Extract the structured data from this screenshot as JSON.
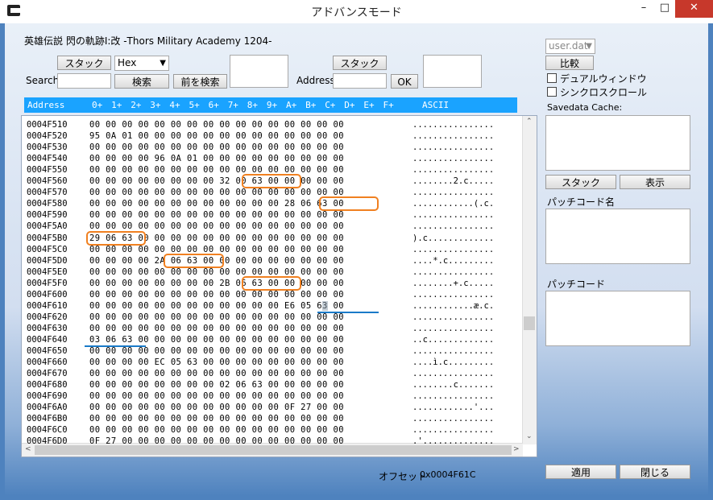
{
  "window": {
    "title": "アドバンスモード",
    "min": "–",
    "max": "□",
    "close": "✕"
  },
  "game_title": "英雄伝説 閃の軌跡I:改 -Thors Military Academy 1204-",
  "stack1_label": "スタック",
  "format_select": "Hex",
  "search_label": "Search",
  "search_value": "",
  "search_button": "検索",
  "prev_search_button": "前を検索",
  "stack2_label": "スタック",
  "address_label": "Address",
  "address_value": "",
  "ok_button": "OK",
  "file_select": "user.dat",
  "compare_button": "比較",
  "dual_window_label": "デュアルウィンドウ",
  "sync_scroll_label": "シンクロスクロール",
  "savedata_cache_label": "Savedata Cache:",
  "cache_stack_button": "スタック",
  "cache_show_button": "表示",
  "patch_name_label": "パッチコード名",
  "patch_code_label": "パッチコード",
  "offset_label": "オフセット",
  "offset_value": "0x0004F61C",
  "apply_button": "適用",
  "close_button": "閉じる",
  "hex_header": {
    "address": "Address",
    "columns": [
      "0+",
      "1+",
      "2+",
      "3+",
      "4+",
      "5+",
      "6+",
      "7+",
      "8+",
      "9+",
      "A+",
      "B+",
      "C+",
      "D+",
      "E+",
      "F+"
    ],
    "ascii": "ASCII"
  },
  "rows": [
    {
      "addr": "0004F510",
      "bytes": "00 00 00 00 00 00 00 00 00 00 00 00 00 00 00 00",
      "ascii": "................"
    },
    {
      "addr": "0004F520",
      "bytes": "95 0A 01 00 00 00 00 00 00 00 00 00 00 00 00 00",
      "ascii": "................"
    },
    {
      "addr": "0004F530",
      "bytes": "00 00 00 00 00 00 00 00 00 00 00 00 00 00 00 00",
      "ascii": "................"
    },
    {
      "addr": "0004F540",
      "bytes": "00 00 00 00 96 0A 01 00 00 00 00 00 00 00 00 00",
      "ascii": "................"
    },
    {
      "addr": "0004F550",
      "bytes": "00 00 00 00 00 00 00 00 00 00 00 00 00 00 00 00",
      "ascii": "................"
    },
    {
      "addr": "0004F560",
      "bytes": "00 00 00 00 00 00 00 00 32 00 63 00 00 00 00 00",
      "ascii": "........2.c....."
    },
    {
      "addr": "0004F570",
      "bytes": "00 00 00 00 00 00 00 00 00 00 00 00 00 00 00 00",
      "ascii": "................"
    },
    {
      "addr": "0004F580",
      "bytes": "00 00 00 00 00 00 00 00 00 00 00 00 28 06 63 00",
      "ascii": "............(.c."
    },
    {
      "addr": "0004F590",
      "bytes": "00 00 00 00 00 00 00 00 00 00 00 00 00 00 00 00",
      "ascii": "................"
    },
    {
      "addr": "0004F5A0",
      "bytes": "00 00 00 00 00 00 00 00 00 00 00 00 00 00 00 00",
      "ascii": "................"
    },
    {
      "addr": "0004F5B0",
      "bytes": "29 06 63 00 00 00 00 00 00 00 00 00 00 00 00 00",
      "ascii": ").c............."
    },
    {
      "addr": "0004F5C0",
      "bytes": "00 00 00 00 00 00 00 00 00 00 00 00 00 00 00 00",
      "ascii": "................"
    },
    {
      "addr": "0004F5D0",
      "bytes": "00 00 00 00 2A 06 63 00 00 00 00 00 00 00 00 00",
      "ascii": "....*.c........."
    },
    {
      "addr": "0004F5E0",
      "bytes": "00 00 00 00 00 00 00 00 00 00 00 00 00 00 00 00",
      "ascii": "................"
    },
    {
      "addr": "0004F5F0",
      "bytes": "00 00 00 00 00 00 00 00 2B 06 63 00 00 00 00 00",
      "ascii": "........+.c....."
    },
    {
      "addr": "0004F600",
      "bytes": "00 00 00 00 00 00 00 00 00 00 00 00 00 00 00 00",
      "ascii": "................"
    },
    {
      "addr": "0004F610",
      "bytes": "00 00 00 00 00 00 00 00 00 00 00 00 E6 05 63 00",
      "ascii": "............æ.c."
    },
    {
      "addr": "0004F620",
      "bytes": "00 00 00 00 00 00 00 00 00 00 00 00 00 00 00 00",
      "ascii": "................"
    },
    {
      "addr": "0004F630",
      "bytes": "00 00 00 00 00 00 00 00 00 00 00 00 00 00 00 00",
      "ascii": "................"
    },
    {
      "addr": "0004F640",
      "bytes": "03 06 63 00 00 00 00 00 00 00 00 00 00 00 00 00",
      "ascii": "..c............."
    },
    {
      "addr": "0004F650",
      "bytes": "00 00 00 00 00 00 00 00 00 00 00 00 00 00 00 00",
      "ascii": "................"
    },
    {
      "addr": "0004F660",
      "bytes": "00 00 00 00 EC 05 63 00 00 00 00 00 00 00 00 00",
      "ascii": "....ì.c........."
    },
    {
      "addr": "0004F670",
      "bytes": "00 00 00 00 00 00 00 00 00 00 00 00 00 00 00 00",
      "ascii": "................"
    },
    {
      "addr": "0004F680",
      "bytes": "00 00 00 00 00 00 00 00 02 06 63 00 00 00 00 00",
      "ascii": "........c......."
    },
    {
      "addr": "0004F690",
      "bytes": "00 00 00 00 00 00 00 00 00 00 00 00 00 00 00 00",
      "ascii": "................"
    },
    {
      "addr": "0004F6A0",
      "bytes": "00 00 00 00 00 00 00 00 00 00 00 00 0F 27 00 00",
      "ascii": "............'..."
    },
    {
      "addr": "0004F6B0",
      "bytes": "00 00 00 00 00 00 00 00 00 00 00 00 00 00 00 00",
      "ascii": "................"
    },
    {
      "addr": "0004F6C0",
      "bytes": "00 00 00 00 00 00 00 00 00 00 00 00 00 00 00 00",
      "ascii": "................"
    },
    {
      "addr": "0004F6D0",
      "bytes": "0F 27 00 00 00 00 00 00 00 00 00 00 00 00 00 00",
      "ascii": ".'.............."
    }
  ],
  "scroll_up_arrow": "⌃",
  "scroll_down_arrow": "⌄",
  "scroll_left_arrow": "<",
  "scroll_right_arrow": ">"
}
